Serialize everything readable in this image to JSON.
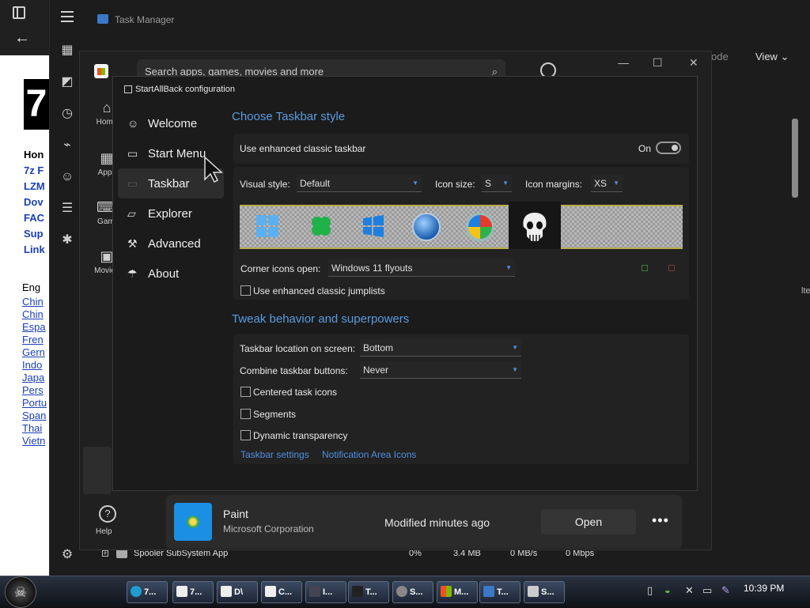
{
  "browser": {
    "links": [
      "Hon",
      "7z F",
      "LZM",
      "Dov",
      "FAC",
      "Sup",
      "Link"
    ],
    "languages_heading": "Eng",
    "languages": [
      "Chin",
      "Chin",
      "Espa",
      "Fren",
      "Gern",
      "Indo",
      "Japa",
      "Pers",
      "Portu",
      "Span",
      "Thai",
      "Vietn"
    ]
  },
  "taskmgr": {
    "title": "Task Manager",
    "mode_label": "ode",
    "view_label": "View",
    "process_row": {
      "name": "Spooler SubSystem App",
      "cpu": "0%",
      "memory": "3.4 MB",
      "disk": "0 MB/s",
      "network": "0 Mbps"
    },
    "side_text": "lte"
  },
  "store": {
    "search_placeholder": "Search apps, games, movies and more",
    "nav": {
      "home": "Home",
      "apps": "Apps",
      "gaming": "Gami",
      "movies": "Movies",
      "help": "Help"
    },
    "paint_card": {
      "name": "Paint",
      "publisher": "Microsoft Corporation",
      "status": "Modified minutes ago",
      "open_label": "Open",
      "more_label": "•••"
    }
  },
  "sab": {
    "title": "StartAllBack configuration",
    "nav": [
      {
        "label": "Welcome",
        "icon": "smile-icon"
      },
      {
        "label": "Start Menu",
        "icon": "start-menu-icon"
      },
      {
        "label": "Taskbar",
        "icon": "taskbar-icon",
        "active": true
      },
      {
        "label": "Explorer",
        "icon": "folder-icon"
      },
      {
        "label": "Advanced",
        "icon": "wrench-icon"
      },
      {
        "label": "About",
        "icon": "about-icon"
      }
    ],
    "section1": {
      "heading": "Choose Taskbar style",
      "enhanced_label": "Use enhanced classic taskbar",
      "enhanced_state": "On",
      "visual_style_label": "Visual style:",
      "visual_style_value": "Default",
      "icon_size_label": "Icon size:",
      "icon_size_value": "S",
      "icon_margins_label": "Icon margins:",
      "icon_margins_value": "XS",
      "corner_icons_label": "Corner icons open:",
      "corner_icons_value": "Windows 11 flyouts",
      "jumplists_label": "Use enhanced classic jumplists"
    },
    "section2": {
      "heading": "Tweak behavior and superpowers",
      "location_label": "Taskbar location on screen:",
      "location_value": "Bottom",
      "combine_label": "Combine taskbar buttons:",
      "combine_value": "Never",
      "centered_label": "Centered task icons",
      "segments_label": "Segments",
      "dynamic_label": "Dynamic transparency",
      "taskbar_settings_link": "Taskbar settings",
      "notification_link": "Notification Area Icons"
    }
  },
  "taskbar": {
    "buttons": [
      "7...",
      "7...",
      "D\\",
      "C...",
      "I...",
      "T...",
      "S...",
      "M...",
      "T...",
      "S..."
    ],
    "clock": "10:39 PM"
  },
  "colors": {
    "accent": "#5b9bdf",
    "link": "#4f8fe0",
    "taskbar_top": "#2a3240"
  }
}
